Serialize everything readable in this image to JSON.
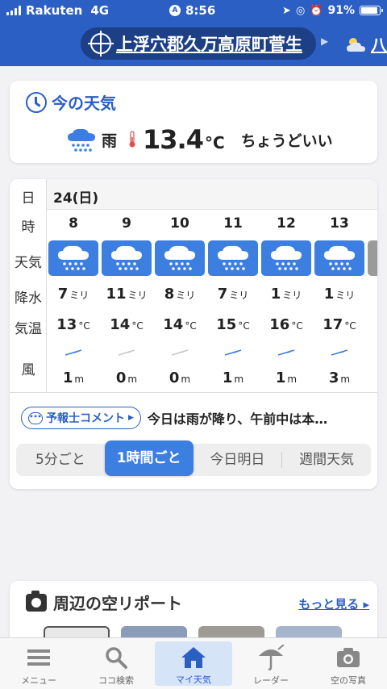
{
  "status_bar": {
    "carrier": "Rakuten",
    "network": "4G",
    "time": "8:56",
    "battery": "91%",
    "battery_level": 0.91
  },
  "location": {
    "name": "上浮穴郡久万高原町菅生",
    "next_partial": "八"
  },
  "current": {
    "title": "今の天気",
    "weather": "雨",
    "temperature": "13.4",
    "unit": "°C",
    "feel": "ちょうどいい"
  },
  "forecast": {
    "labels": {
      "day": "日",
      "hour": "時",
      "weather": "天気",
      "precip": "降水",
      "temp": "気温",
      "wind": "風"
    },
    "date": "24(日)",
    "hours": [
      {
        "hour": "8",
        "precip": "7",
        "temp": "13",
        "wind": "1",
        "wind_dir": "blue"
      },
      {
        "hour": "9",
        "precip": "11",
        "temp": "14",
        "wind": "0",
        "wind_dir": "gray"
      },
      {
        "hour": "10",
        "precip": "8",
        "temp": "14",
        "wind": "0",
        "wind_dir": "gray"
      },
      {
        "hour": "11",
        "precip": "7",
        "temp": "15",
        "wind": "1",
        "wind_dir": "blue"
      },
      {
        "hour": "12",
        "precip": "1",
        "temp": "16",
        "wind": "1",
        "wind_dir": "blue"
      },
      {
        "hour": "13",
        "precip": "1",
        "temp": "17",
        "wind": "3",
        "wind_dir": "blue"
      }
    ],
    "precip_unit": "ミリ",
    "temp_unit": "°C",
    "wind_unit": "m",
    "comment_button": "予報士コメント",
    "comment_text": "今日は雨が降り、午前中は本…",
    "segments": [
      "5分ごと",
      "1時間ごと",
      "今日明日",
      "週間天気"
    ],
    "active_segment": 1
  },
  "report": {
    "title": "周辺の空リポート",
    "more": "もっと見る"
  },
  "tabbar": [
    {
      "label": "メニュー",
      "icon": "menu-icon"
    },
    {
      "label": "ココ検索",
      "icon": "search-icon"
    },
    {
      "label": "マイ天気",
      "icon": "home-icon"
    },
    {
      "label": "レーダー",
      "icon": "radar-umbrella-icon"
    },
    {
      "label": "空の写真",
      "icon": "camera-icon"
    }
  ],
  "colors": {
    "accent": "#2b5fc4",
    "tile": "#3c7fe0",
    "tabActiveBg": "#d6e4f8"
  }
}
